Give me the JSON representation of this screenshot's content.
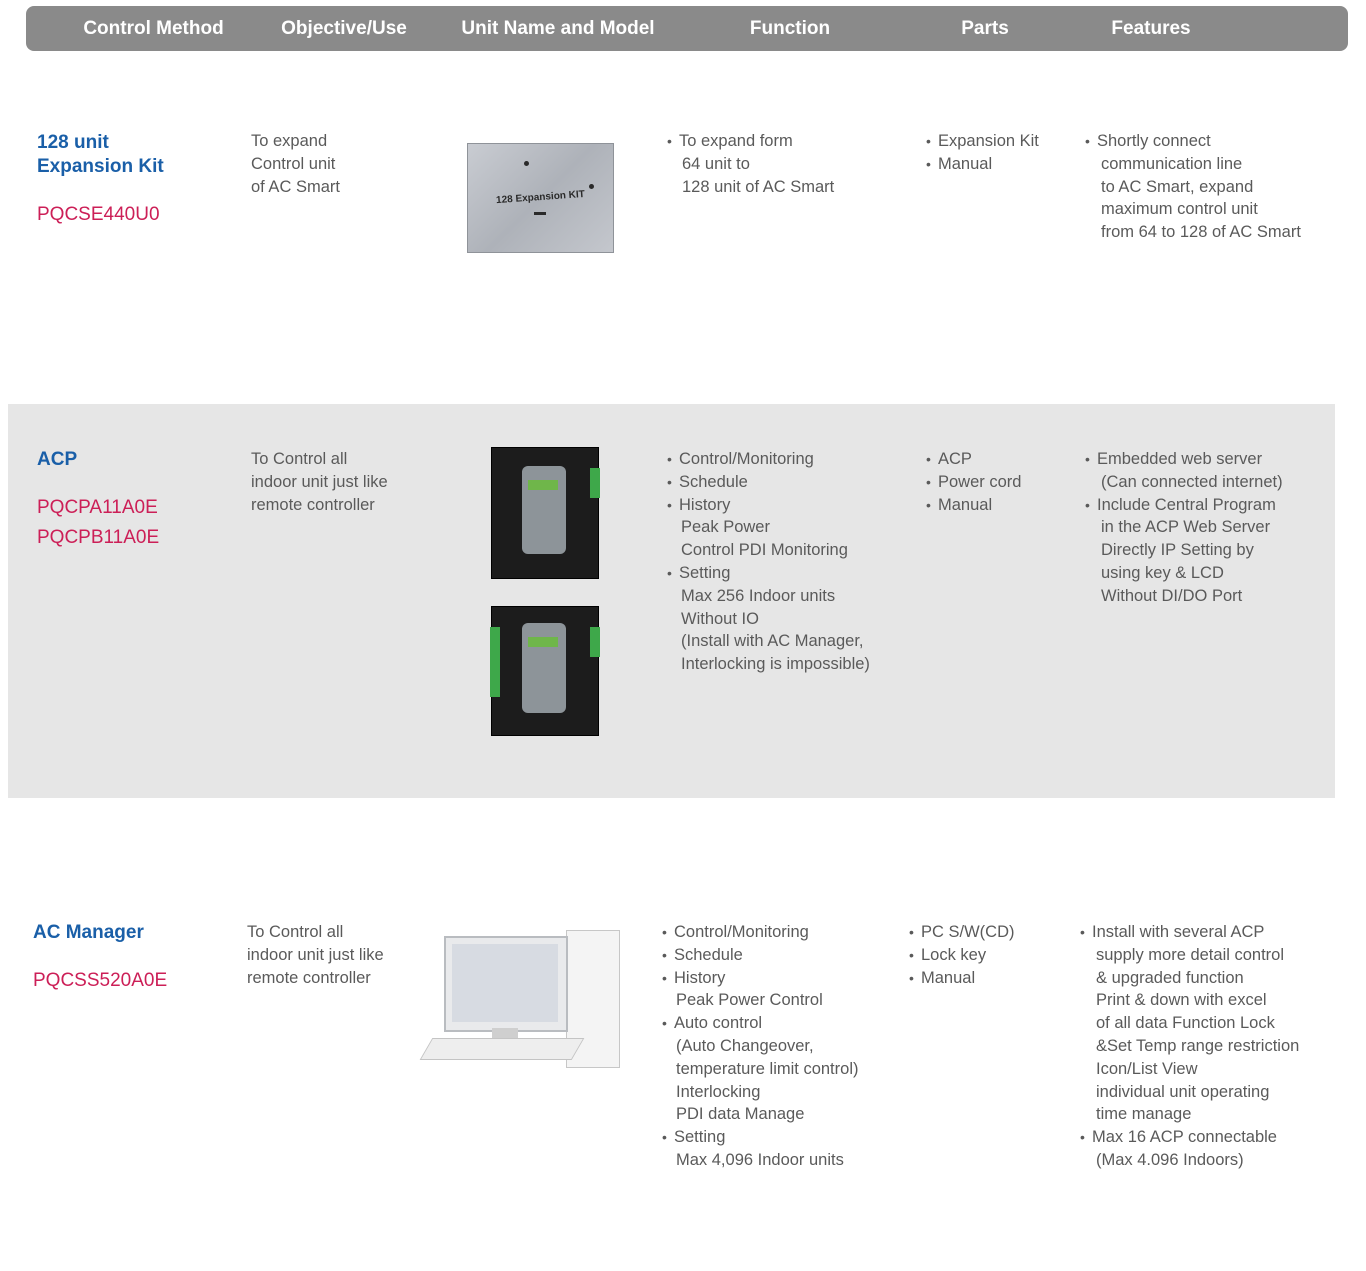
{
  "header": {
    "columns": [
      "Control Method",
      "Objective/Use",
      "Unit Name and Model",
      "Function",
      "Parts",
      "Features"
    ]
  },
  "rows": [
    {
      "title_lines": [
        "128 unit",
        "Expansion Kit"
      ],
      "models": [
        "PQCSE440U0"
      ],
      "objective_lines": [
        "To expand",
        "Control unit",
        "of AC Smart"
      ],
      "image_label": "128 Expansion KIT",
      "functions": [
        {
          "lines": [
            "To expand form",
            "64 unit to",
            "128 unit of AC Smart"
          ]
        }
      ],
      "parts": [
        "Expansion Kit",
        "Manual"
      ],
      "features": [
        {
          "lines": [
            "Shortly connect",
            "communication line",
            "to AC Smart, expand",
            "maximum control unit",
            "from 64 to 128 of AC Smart"
          ]
        }
      ]
    },
    {
      "title_lines": [
        "ACP"
      ],
      "models": [
        "PQCPA11A0E",
        "PQCPB11A0E"
      ],
      "objective_lines": [
        "To Control all",
        "indoor unit just like",
        "remote controller"
      ],
      "functions": [
        {
          "lines": [
            "Control/Monitoring"
          ]
        },
        {
          "lines": [
            "Schedule"
          ]
        },
        {
          "lines": [
            "History",
            "Peak Power",
            "Control PDI Monitoring"
          ]
        },
        {
          "lines": [
            "Setting",
            "Max 256 Indoor units",
            "Without IO",
            "(Install with AC Manager,",
            "Interlocking is impossible)"
          ]
        }
      ],
      "parts": [
        "ACP",
        "Power cord",
        "Manual"
      ],
      "features": [
        {
          "lines": [
            "Embedded web server",
            "(Can connected internet)"
          ]
        },
        {
          "lines": [
            "Include Central Program",
            "in the ACP Web Server",
            "Directly IP Setting by",
            "using key & LCD",
            "Without DI/DO Port"
          ]
        }
      ]
    },
    {
      "title_lines": [
        "AC Manager"
      ],
      "models": [
        "PQCSS520A0E"
      ],
      "objective_lines": [
        "To Control all",
        "indoor unit just like",
        "remote controller"
      ],
      "functions": [
        {
          "lines": [
            "Control/Monitoring"
          ]
        },
        {
          "lines": [
            "Schedule"
          ]
        },
        {
          "lines": [
            "History",
            "Peak Power Control"
          ]
        },
        {
          "lines": [
            "Auto control",
            "(Auto Changeover,",
            "temperature limit control)",
            "Interlocking",
            "PDI data Manage"
          ]
        },
        {
          "lines": [
            "Setting",
            "Max 4,096 Indoor units"
          ]
        }
      ],
      "parts": [
        "PC S/W(CD)",
        "Lock key",
        "Manual"
      ],
      "features": [
        {
          "lines": [
            "Install with several ACP",
            "supply more detail control",
            "& upgraded function",
            "Print & down with excel",
            "of all data Function Lock",
            "&Set Temp range restriction",
            "Icon/List View",
            "individual unit operating",
            "time manage"
          ]
        },
        {
          "lines": [
            "Max 16 ACP connectable",
            "(Max 4.096 Indoors)"
          ]
        }
      ]
    }
  ]
}
